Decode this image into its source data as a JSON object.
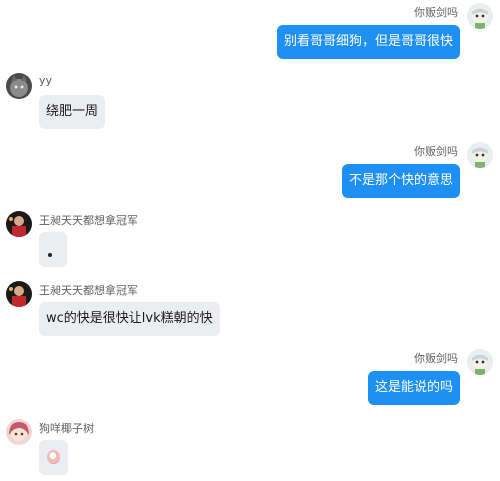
{
  "messages": [
    {
      "side": "right",
      "sender": "你贩剑吗",
      "text": "别看哥哥细狗，但是哥哥很快",
      "avatar_icon": "anime-avatar-icon"
    },
    {
      "side": "left",
      "sender": "yy",
      "text": "绕肥一周",
      "avatar_icon": "cat-avatar-icon"
    },
    {
      "side": "right",
      "sender": "你贩剑吗",
      "text": "不是那个快的意思",
      "avatar_icon": "anime-avatar-icon"
    },
    {
      "side": "left",
      "sender": "王昶天天都想拿冠军",
      "text": "。",
      "avatar_icon": "player-avatar-icon"
    },
    {
      "side": "left",
      "sender": "王昶天天都想拿冠军",
      "text": "wc的快是很快让lvk糕朝的快",
      "avatar_icon": "player-avatar-icon"
    },
    {
      "side": "right",
      "sender": "你贩剑吗",
      "text": "这是能说的吗",
      "avatar_icon": "anime-avatar-icon"
    },
    {
      "side": "left",
      "sender": "狗咩椰子树",
      "text": "",
      "sticker_icon": "sticker-emoji-icon",
      "avatar_icon": "pink-hair-avatar-icon"
    }
  ],
  "colors": {
    "outgoing_bubble": "#1e8ff3",
    "incoming_bubble": "#ecedf1",
    "background": "#ffffff"
  }
}
